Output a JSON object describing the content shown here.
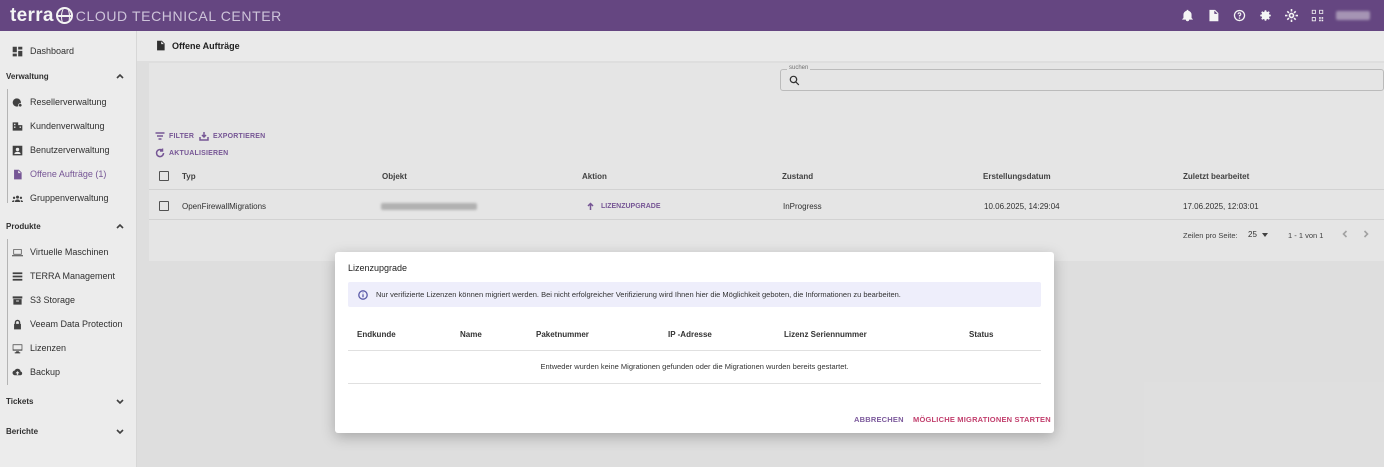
{
  "header": {
    "brand_terra": "terra",
    "brand_text": "CLOUD TECHNICAL CENTER",
    "icons": [
      "bell-icon",
      "document-icon",
      "help-icon",
      "settings-icon",
      "gear-icon",
      "qr-icon"
    ]
  },
  "sidebar": {
    "dashboard": "Dashboard",
    "sections": {
      "verwaltung": "Verwaltung",
      "produkte": "Produkte",
      "tickets": "Tickets",
      "berichte": "Berichte"
    },
    "verwaltung_items": [
      {
        "label": "Resellerverwaltung",
        "icon": "reseller-icon"
      },
      {
        "label": "Kundenverwaltung",
        "icon": "building-icon"
      },
      {
        "label": "Benutzerverwaltung",
        "icon": "user-card-icon"
      },
      {
        "label": "Offene Aufträge (1)",
        "icon": "orders-icon",
        "active": true
      },
      {
        "label": "Gruppenverwaltung",
        "icon": "group-icon"
      }
    ],
    "produkte_items": [
      {
        "label": "Virtuelle Maschinen",
        "icon": "laptop-icon"
      },
      {
        "label": "TERRA Management",
        "icon": "list-icon"
      },
      {
        "label": "S3 Storage",
        "icon": "archive-icon"
      },
      {
        "label": "Veeam Data Protection",
        "icon": "lock-icon"
      },
      {
        "label": "Lizenzen",
        "icon": "monitor-icon"
      },
      {
        "label": "Backup",
        "icon": "cloud-upload-icon"
      }
    ]
  },
  "page": {
    "title": "Offene Aufträge",
    "search_label": "suchen",
    "search_value": "",
    "toolbar": {
      "filter": "FILTER",
      "export": "EXPORTIEREN",
      "refresh": "AKTUALISIEREN"
    },
    "table": {
      "columns": [
        "Typ",
        "Objekt",
        "Aktion",
        "Zustand",
        "Erstellungsdatum",
        "Zuletzt bearbeitet"
      ],
      "rows": [
        {
          "typ": "OpenFirewallMigrations",
          "objekt": "",
          "aktion": "LIZENZUPGRADE",
          "zustand": "InProgress",
          "erstellungsdatum": "10.06.2025, 14:29:04",
          "zuletzt_bearbeitet": "17.06.2025, 12:03:01"
        }
      ]
    },
    "pagination": {
      "rows_per_page_label": "Zeilen pro Seite:",
      "rows_per_page": "25",
      "range": "1 - 1 von 1"
    }
  },
  "dialog": {
    "title": "Lizenzupgrade",
    "info": "Nur verifizierte Lizenzen können migriert werden. Bei nicht erfolgreicher Verifizierung wird Ihnen hier die Möglichkeit geboten, die Informationen zu bearbeiten.",
    "columns": [
      "Endkunde",
      "Name",
      "Paketnummer",
      "IP -Adresse",
      "Lizenz Seriennummer",
      "Status"
    ],
    "empty_message": "Entweder wurden keine Migrationen gefunden oder die Migrationen wurden bereits gestartet.",
    "cancel": "ABBRECHEN",
    "start": "MÖGLICHE MIGRATIONEN STARTEN"
  },
  "colors": {
    "topbar": "#6a4a87",
    "accent": "#7c5a9c",
    "start_button": "#c2406e"
  }
}
